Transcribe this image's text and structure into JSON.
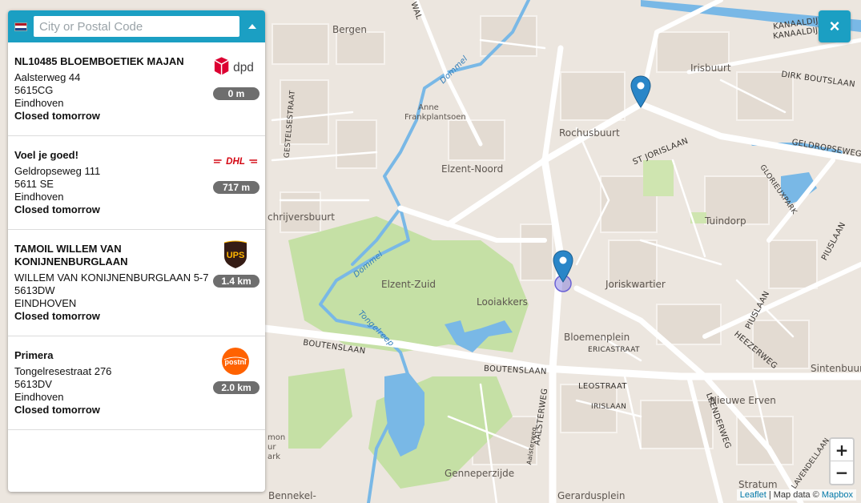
{
  "search": {
    "placeholder": "City or Postal Code",
    "value": ""
  },
  "colors": {
    "accent": "#1b9fc3",
    "distance_badge": "#6e6e6e",
    "pin": "#2a86c8",
    "water": "#79b8e6",
    "park": "#c5e0a5",
    "map_bg": "#ece6df"
  },
  "locations": [
    {
      "name": "NL10485 BLOEMBOETIEK MAJAN",
      "street": "Aalsterweg 44",
      "postal": "5615CG",
      "city": "Eindhoven",
      "status": "Closed tomorrow",
      "carrier": "dpd",
      "carrier_label": "dpd",
      "distance": "0 m"
    },
    {
      "name": "Voel je goed!",
      "street": "Geldropseweg 111",
      "postal": "5611 SE",
      "city": "Eindhoven",
      "status": "Closed tomorrow",
      "carrier": "dhl",
      "carrier_label": "DHL",
      "distance": "717 m"
    },
    {
      "name": "TAMOIL WILLEM VAN KONIJNENBURGLAAN",
      "street": "WILLEM VAN KONIJNENBURGLAAN 5-7",
      "postal": "5613DW",
      "city": "EINDHOVEN",
      "status": "Closed tomorrow",
      "carrier": "ups",
      "carrier_label": "UPS",
      "distance": "1.4 km"
    },
    {
      "name": "Primera",
      "street": "Tongelresestraat 276",
      "postal": "5613DV",
      "city": "Eindhoven",
      "status": "Closed tomorrow",
      "carrier": "postnl",
      "carrier_label": "postnl",
      "distance": "2.0 km"
    }
  ],
  "map": {
    "areas": [
      "Bergen",
      "Irisbuurt",
      "Rochusbuurt",
      "Elzent-Noord",
      "Anne Frankplantsoen",
      "Tuindorp",
      "Joriskwartier",
      "Elzent-Zuid",
      "Looiakkers",
      "Bloemenplein",
      "Sintenbuurt",
      "Nieuwe Erven",
      "Stratum",
      "Genneperzijde",
      "Gerardusplein",
      "Bennekel-",
      "chrijversbuurt",
      "mon",
      "ur",
      "ark"
    ],
    "streets": [
      "KANAALDIJK ZUID",
      "KANAALDIJK",
      "DIRK BOUTSLAAN",
      "GELDROPSEWEG",
      "ST JORISLAAN",
      "GLORIEUXPARK",
      "PIUSLAAN",
      "PIUSLAAN",
      "HEEZERWEG",
      "BOUTENSLAAN",
      "BOUTENSLAAN",
      "LEOSTRAAT",
      "IRISLAAN",
      "ERICASTRAAT",
      "AALSTERWEG",
      "Aalsterweg",
      "LEENDERWEG",
      "LAVENDELLAAN",
      "GESTELSESTRAAT",
      "WAL"
    ],
    "water_labels": [
      "Dommel",
      "Dommel",
      "Tongelreep"
    ]
  },
  "controls": {
    "close": "×",
    "zoom_in": "+",
    "zoom_out": "−"
  },
  "attribution": {
    "leaflet": "Leaflet",
    "sep": " | Map data © ",
    "mapbox": "Mapbox"
  }
}
